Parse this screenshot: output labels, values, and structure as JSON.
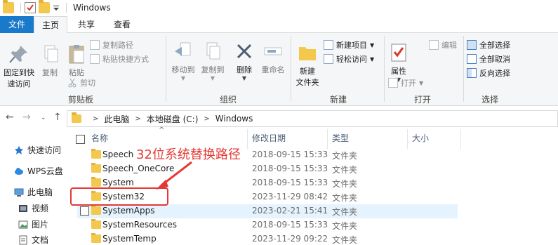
{
  "window": {
    "title": "Windows"
  },
  "tabs": {
    "file": "文件",
    "home": "主页",
    "share": "共享",
    "view": "查看"
  },
  "ribbon": {
    "clipboard": {
      "pin": "固定到快\n速访问",
      "pin_l1": "固定到快",
      "pin_l2": "速访问",
      "copy": "复制",
      "paste": "粘贴",
      "copy_path": "复制路径",
      "paste_shortcut": "粘贴快捷方式",
      "cut": "剪切",
      "label": "剪贴板"
    },
    "organize": {
      "move_to": "移动到",
      "copy_to": "复制到",
      "delete": "删除",
      "rename": "重命名",
      "label": "组织"
    },
    "new": {
      "new_folder_l1": "新建",
      "new_folder_l2": "文件夹",
      "new_item": "新建项目",
      "easy_access": "轻松访问",
      "label": "新建"
    },
    "open": {
      "properties": "属性",
      "open": "打开",
      "edit": "编辑",
      "label": "打开"
    },
    "select": {
      "select_all": "全部选择",
      "select_none": "全部取消",
      "invert": "反向选择",
      "label": "选择"
    }
  },
  "address": {
    "crumbs": [
      "此电脑",
      "本地磁盘 (C:)",
      "Windows"
    ]
  },
  "sidebar": {
    "items": [
      "快速访问",
      "WPS云盘",
      "此电脑",
      "视频",
      "图片",
      "文档"
    ]
  },
  "columns": {
    "name": "名称",
    "date": "修改日期",
    "type": "类型",
    "size": "大小"
  },
  "files": [
    {
      "name": "Speech",
      "date": "2018-09-15 15:33",
      "type": "文件夹"
    },
    {
      "name": "Speech_OneCore",
      "date": "2018-09-15 15:33",
      "type": "文件夹"
    },
    {
      "name": "System",
      "date": "2018-09-15 15:33",
      "type": "文件夹"
    },
    {
      "name": "System32",
      "date": "2023-11-29 08:42",
      "type": "文件夹"
    },
    {
      "name": "SystemApps",
      "date": "2023-02-21 15:41",
      "type": "文件夹"
    },
    {
      "name": "SystemResources",
      "date": "2018-09-15 15:33",
      "type": "文件夹"
    },
    {
      "name": "SystemTemp",
      "date": "2023-11-29 09:22",
      "type": "文件夹"
    }
  ],
  "annotation": {
    "text": "32位系统替换路径",
    "color": "#e53935"
  },
  "colors": {
    "accent": "#1979ca",
    "folder": "#f2c94c",
    "hover": "#e5f3ff"
  }
}
